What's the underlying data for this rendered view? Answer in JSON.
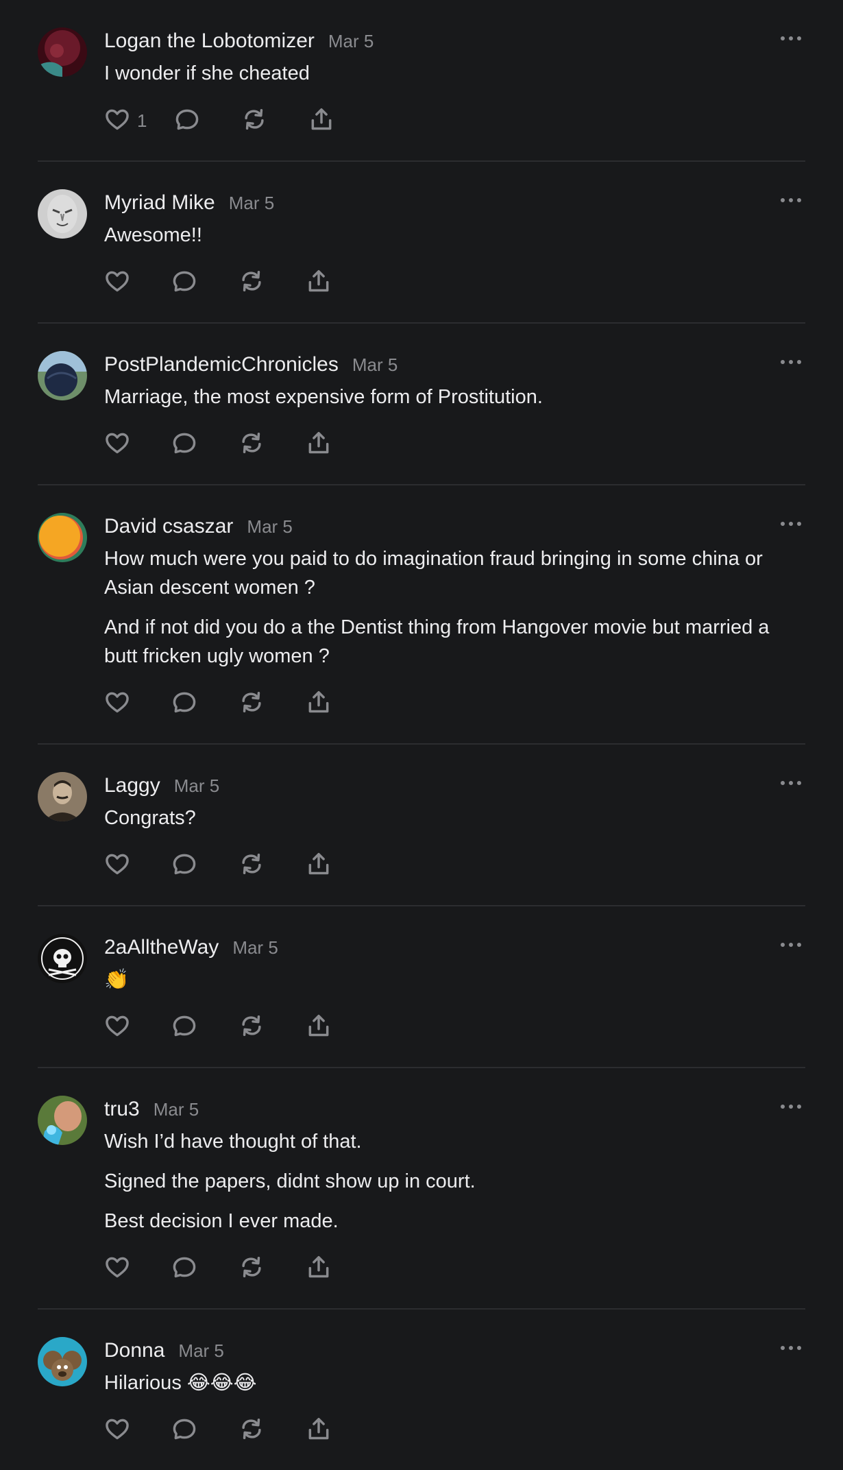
{
  "comments": [
    {
      "author": "Logan the Lobotomizer",
      "date": "Mar 5",
      "paragraphs": [
        "I wonder if she cheated"
      ],
      "likes": "1",
      "avatar": {
        "style": "logan",
        "colors": [
          "#6a1a2a",
          "#3a8a88"
        ]
      }
    },
    {
      "author": "Myriad Mike",
      "date": "Mar 5",
      "paragraphs": [
        "Awesome!!"
      ],
      "likes": "",
      "avatar": {
        "style": "mike",
        "colors": [
          "#dcdcdc",
          "#444444"
        ]
      }
    },
    {
      "author": "PostPlandemicChronicles",
      "date": "Mar 5",
      "paragraphs": [
        "Marriage, the most expensive form of Prostitution."
      ],
      "likes": "",
      "avatar": {
        "style": "post",
        "colors": [
          "#6e8f6a",
          "#1e2a44"
        ]
      }
    },
    {
      "author": "David csaszar",
      "date": "Mar 5",
      "paragraphs": [
        "How much were you paid to do imagination fraud bringing in some china or Asian descent women ?",
        "And if not did you do a the Dentist thing from Hangover movie but married a butt fricken ugly women ?"
      ],
      "likes": "",
      "avatar": {
        "style": "david",
        "colors": [
          "#f5a623",
          "#2e7d5b",
          "#e05a3a"
        ]
      }
    },
    {
      "author": "Laggy",
      "date": "Mar 5",
      "paragraphs": [
        "Congrats?"
      ],
      "likes": "",
      "avatar": {
        "style": "laggy",
        "colors": [
          "#8a7a66",
          "#2b241d"
        ]
      }
    },
    {
      "author": "2aAlltheWay",
      "date": "Mar 5",
      "paragraphs": [
        "👏"
      ],
      "likes": "",
      "avatar": {
        "style": "skull",
        "colors": [
          "#111111",
          "#f2f2f2"
        ]
      }
    },
    {
      "author": "tru3",
      "date": "Mar 5",
      "paragraphs": [
        "Wish I’d have thought of that.",
        "Signed the papers, didnt show up in court.",
        "Best decision I ever made."
      ],
      "likes": "",
      "avatar": {
        "style": "tru3",
        "colors": [
          "#5a7a3a",
          "#3fb6e0",
          "#d49a7a"
        ]
      }
    },
    {
      "author": "Donna",
      "date": "Mar 5",
      "paragraphs": [
        "Hilarious 😂😂😂"
      ],
      "likes": "",
      "avatar": {
        "style": "donna",
        "colors": [
          "#2aa8c8",
          "#7a5a3a"
        ]
      }
    }
  ],
  "icons": {
    "like": "heart-icon",
    "reply": "comment-bubble-icon",
    "restack": "restack-icon",
    "share": "share-icon",
    "more": "more-dots-icon"
  }
}
